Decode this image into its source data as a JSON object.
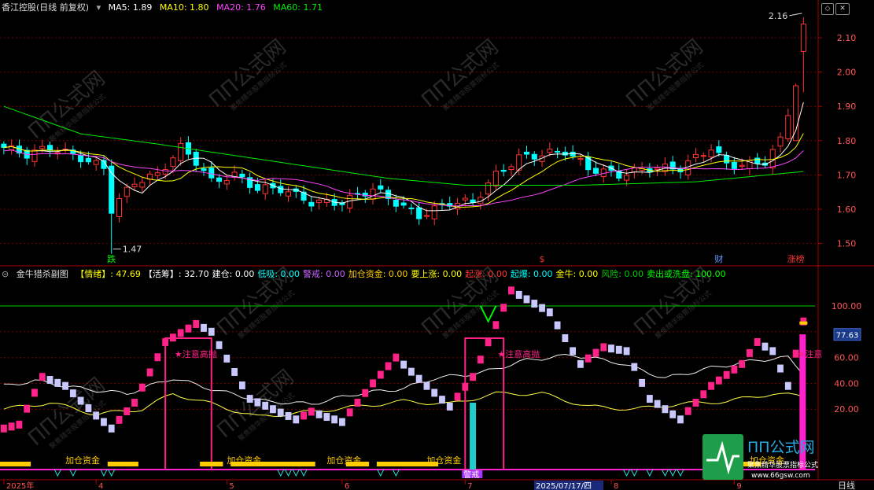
{
  "title": "香江控股(日线 前复权)",
  "ma_legend": [
    {
      "label": "MA5: 1.89",
      "color": "#ffffff"
    },
    {
      "label": "MA10: 1.80",
      "color": "#ffff00"
    },
    {
      "label": "MA20: 1.76",
      "color": "#ff44ff"
    },
    {
      "label": "MA60: 1.71",
      "color": "#00ee00"
    }
  ],
  "price_axis": {
    "ticks": [
      "2.10",
      "2.00",
      "1.90",
      "1.80",
      "1.70",
      "1.60",
      "1.50"
    ],
    "range": [
      1.45,
      2.2
    ]
  },
  "price_marks": {
    "high": "2.16",
    "low": "1.47"
  },
  "event_markers": [
    {
      "label": "跌",
      "color": "#00ff00",
      "bar": 14
    },
    {
      "label": "$",
      "color": "#ff3333",
      "bar": 70
    },
    {
      "label": "财",
      "color": "#6699ff",
      "bar": 93
    },
    {
      "label": "涨榜",
      "color": "#ff3333",
      "bar": 103
    }
  ],
  "sub": {
    "name": "金牛猎杀副图",
    "items": [
      {
        "label": "【情绪】: 47.69",
        "color": "#ffff00"
      },
      {
        "label": "【活筹】: 32.70",
        "color": "#ffffff"
      },
      {
        "label": "建仓: 0.00",
        "color": "#ffffff"
      },
      {
        "label": "低吸: 0.00",
        "color": "#00ffff"
      },
      {
        "label": "警戒: 0.00",
        "color": "#cc66ff"
      },
      {
        "label": "加仓资金: 0.00",
        "color": "#ffcc00"
      },
      {
        "label": "要上涨: 0.00",
        "color": "#ffff00"
      },
      {
        "label": "起涨: 0.00",
        "color": "#ff3333"
      },
      {
        "label": "起爆: 0.00",
        "color": "#00ffff"
      },
      {
        "label": "金牛: 0.00",
        "color": "#ffff00"
      },
      {
        "label": "风险: 0.00",
        "color": "#00cc00"
      },
      {
        "label": "卖出或洗盘: 100.00",
        "color": "#00ff00"
      }
    ],
    "axis_ticks": [
      "100.00",
      "80.00",
      "60.00",
      "40.00",
      "20.00"
    ],
    "current_value": "77.63",
    "notes": [
      {
        "label": "★注意高抛",
        "bar": 22
      },
      {
        "label": "★注意高抛",
        "bar": 64
      },
      {
        "label": "★注意",
        "bar": 103
      }
    ],
    "add_fund_labels": [
      {
        "label": "加仓资金",
        "bar": 8
      },
      {
        "label": "加仓资金",
        "bar": 29
      },
      {
        "label": "加仓资金",
        "bar": 42
      },
      {
        "label": "加仓资金",
        "bar": 55
      },
      {
        "label": "加仓资金",
        "bar": 97
      }
    ],
    "warning_label": "警戒"
  },
  "x_axis": [
    {
      "label": "2025年",
      "bar": 0
    },
    {
      "label": "4",
      "bar": 12
    },
    {
      "label": "5",
      "bar": 29
    },
    {
      "label": "6",
      "bar": 44
    },
    {
      "label": "7",
      "bar": 60
    },
    {
      "label": "2025/07/17/四",
      "bar": 70,
      "highlight": true
    },
    {
      "label": "8",
      "bar": 79
    },
    {
      "label": "9",
      "bar": 95
    }
  ],
  "period_label": "日线",
  "watermark": {
    "brand": "ΠΠ公式网",
    "url": "www.66gsw.com",
    "slogan": "聚焦精华股票指标公式"
  },
  "colors": {
    "up": "#ff3333",
    "down": "#00ffff",
    "grid": "#7a0000",
    "ma5": "#ffffff",
    "ma10": "#ffff00",
    "ma20": "#ff44ff",
    "ma60": "#00ee00",
    "pink": "#ff2288",
    "lavender": "#c8c8ff",
    "orange": "#ffcc00"
  }
}
